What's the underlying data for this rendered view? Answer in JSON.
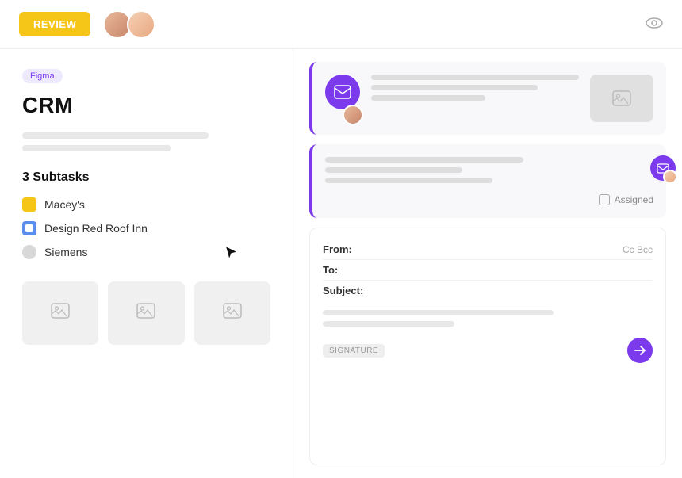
{
  "header": {
    "review_label": "REVIEW",
    "eye_icon": "👁"
  },
  "left_panel": {
    "badge": "Figma",
    "title": "CRM",
    "subtasks_heading": "3 Subtasks",
    "subtasks": [
      {
        "label": "Macey's",
        "color": "yellow"
      },
      {
        "label": "Design Red Roof Inn",
        "color": "blue"
      },
      {
        "label": "Siemens",
        "color": "gray"
      }
    ],
    "image_placeholder_icon": "🖼"
  },
  "right_panel": {
    "email_icon": "✉",
    "assigned_label": "Assigned",
    "compose": {
      "from_label": "From:",
      "to_label": "To:",
      "subject_label": "Subject:",
      "cc_label": "Cc Bcc",
      "signature_label": "SIGNATURE"
    }
  }
}
